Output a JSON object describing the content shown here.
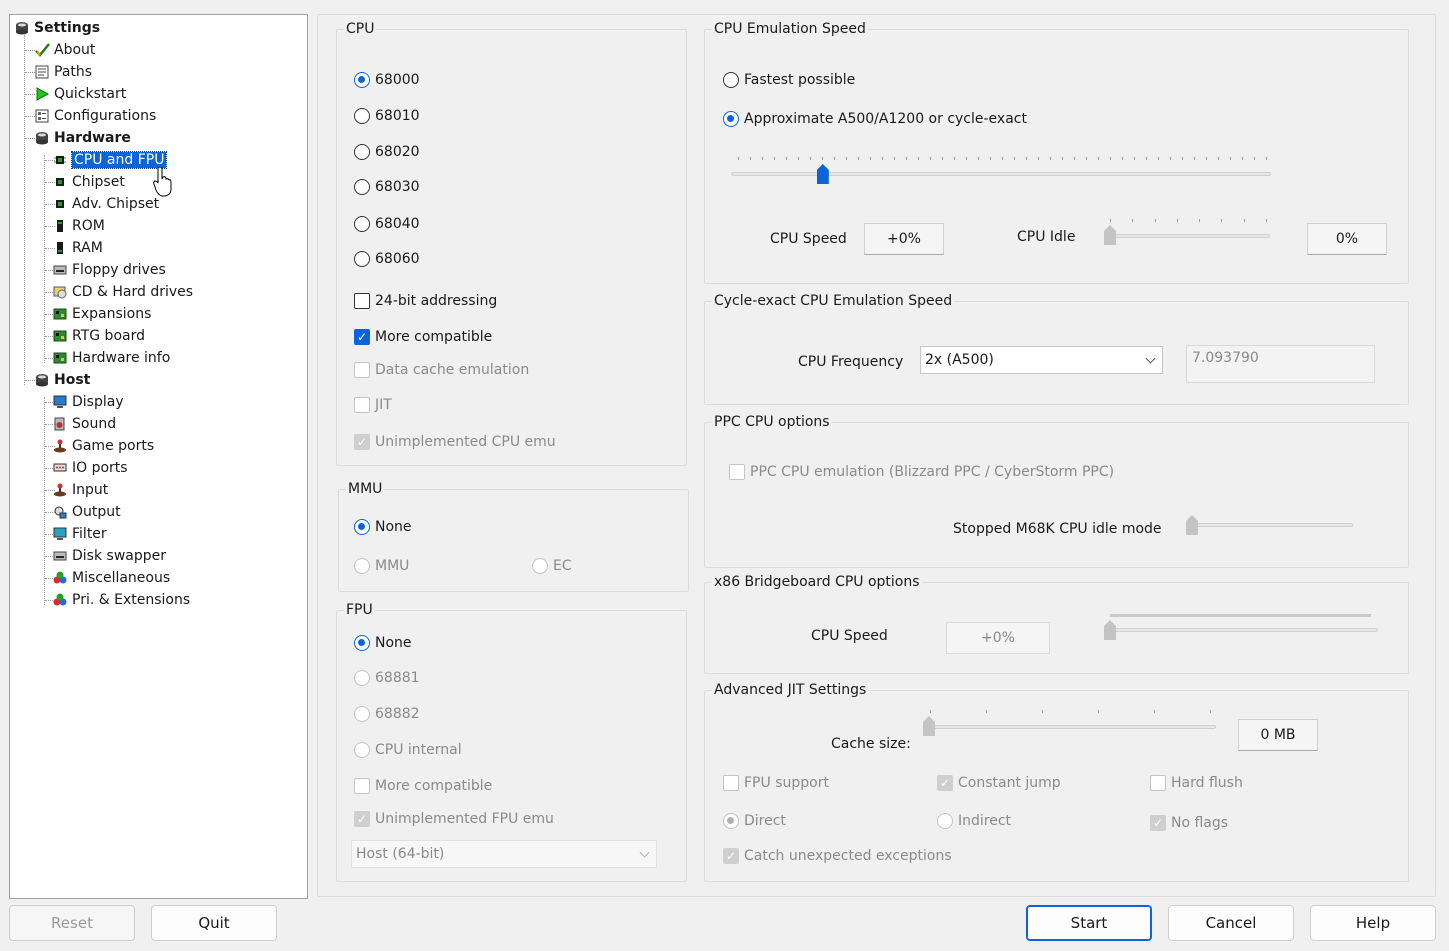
{
  "tree": {
    "root": "Settings",
    "items": [
      {
        "label": "About",
        "icon": "checkmark-icon"
      },
      {
        "label": "Paths",
        "icon": "paths-icon"
      },
      {
        "label": "Quickstart",
        "icon": "play-icon"
      },
      {
        "label": "Configurations",
        "icon": "config-icon"
      }
    ],
    "hardware": {
      "label": "Hardware",
      "items": [
        {
          "label": "CPU and FPU",
          "icon": "chip-icon",
          "selected": true
        },
        {
          "label": "Chipset",
          "icon": "chip-icon"
        },
        {
          "label": "Adv. Chipset",
          "icon": "chip-icon"
        },
        {
          "label": "ROM",
          "icon": "rom-icon"
        },
        {
          "label": "RAM",
          "icon": "ram-icon"
        },
        {
          "label": "Floppy drives",
          "icon": "floppy-icon"
        },
        {
          "label": "CD & Hard drives",
          "icon": "disk-icon"
        },
        {
          "label": "Expansions",
          "icon": "board-icon"
        },
        {
          "label": "RTG board",
          "icon": "board-icon"
        },
        {
          "label": "Hardware info",
          "icon": "board-icon"
        }
      ]
    },
    "host": {
      "label": "Host",
      "items": [
        {
          "label": "Display",
          "icon": "monitor-icon"
        },
        {
          "label": "Sound",
          "icon": "speaker-icon"
        },
        {
          "label": "Game ports",
          "icon": "joystick-icon"
        },
        {
          "label": "IO ports",
          "icon": "port-icon"
        },
        {
          "label": "Input",
          "icon": "joystick-icon"
        },
        {
          "label": "Output",
          "icon": "output-icon"
        },
        {
          "label": "Filter",
          "icon": "monitor-icon"
        },
        {
          "label": "Disk swapper",
          "icon": "floppy-icon"
        },
        {
          "label": "Miscellaneous",
          "icon": "balls-icon"
        },
        {
          "label": "Pri. & Extensions",
          "icon": "balls-icon"
        }
      ]
    }
  },
  "cpu": {
    "title": "CPU",
    "options": [
      "68000",
      "68010",
      "68020",
      "68030",
      "68040",
      "68060"
    ],
    "selected": "68000",
    "addr24": "24-bit addressing",
    "more_compatible": "More compatible",
    "data_cache": "Data cache emulation",
    "jit": "JIT",
    "unimpl": "Unimplemented CPU emu"
  },
  "mmu": {
    "title": "MMU",
    "none": "None",
    "mmu": "MMU",
    "ec": "EC"
  },
  "fpu": {
    "title": "FPU",
    "none": "None",
    "f68881": "68881",
    "f68882": "68882",
    "internal": "CPU internal",
    "more_compatible": "More compatible",
    "unimpl": "Unimplemented FPU emu",
    "host_mode": "Host (64-bit)"
  },
  "speed": {
    "title": "CPU Emulation Speed",
    "fastest": "Fastest possible",
    "approx": "Approximate A500/A1200 or cycle-exact",
    "speed_slider_fraction": 0.17,
    "cpu_speed_label": "CPU Speed",
    "cpu_speed_value": "+0%",
    "cpu_idle_label": "CPU Idle",
    "cpu_idle_value": "0%",
    "cpu_idle_fraction": 0
  },
  "cycle": {
    "title": "Cycle-exact CPU Emulation Speed",
    "freq_label": "CPU Frequency",
    "freq_value": "2x (A500)",
    "freq_display": "7.093790"
  },
  "ppc": {
    "title": "PPC CPU options",
    "emulation": "PPC CPU emulation (Blizzard PPC / CyberStorm PPC)",
    "idle_label": "Stopped M68K CPU idle mode"
  },
  "x86": {
    "title": "x86 Bridgeboard CPU options",
    "speed_label": "CPU Speed",
    "speed_value": "+0%"
  },
  "jit": {
    "title": "Advanced JIT Settings",
    "cache_label": "Cache size:",
    "cache_value": "0 MB",
    "fpu_support": "FPU support",
    "constant_jump": "Constant jump",
    "hard_flush": "Hard flush",
    "direct": "Direct",
    "indirect": "Indirect",
    "no_flags": "No flags",
    "catch": "Catch unexpected exceptions"
  },
  "buttons": {
    "reset": "Reset",
    "quit": "Quit",
    "start": "Start",
    "cancel": "Cancel",
    "help": "Help"
  },
  "colors": {
    "accent": "#0c64d8",
    "selection": "#0c64d8"
  }
}
